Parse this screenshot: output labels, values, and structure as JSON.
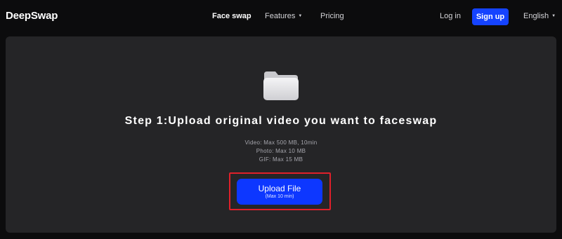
{
  "brand": {
    "name": "DeepSwap"
  },
  "nav": {
    "face_swap": "Face swap",
    "features": "Features",
    "pricing": "Pricing",
    "login": "Log in",
    "signup": "Sign up",
    "language": "English"
  },
  "upload": {
    "step_title": "Step 1:Upload original video you want to faceswap",
    "limits": [
      "Video: Max 500 MB, 10min",
      "Photo: Max 10 MB",
      "GIF: Max 15 MB"
    ],
    "button_label": "Upload File",
    "button_sub": "(Max 10 min)"
  },
  "colors": {
    "accent": "#1543ff",
    "panel_bg": "#252527",
    "page_bg": "#0c0c0d",
    "highlight": "#e0202a"
  },
  "icons": {
    "upload_area": "folder-icon",
    "dropdown": "caret-down-icon"
  }
}
